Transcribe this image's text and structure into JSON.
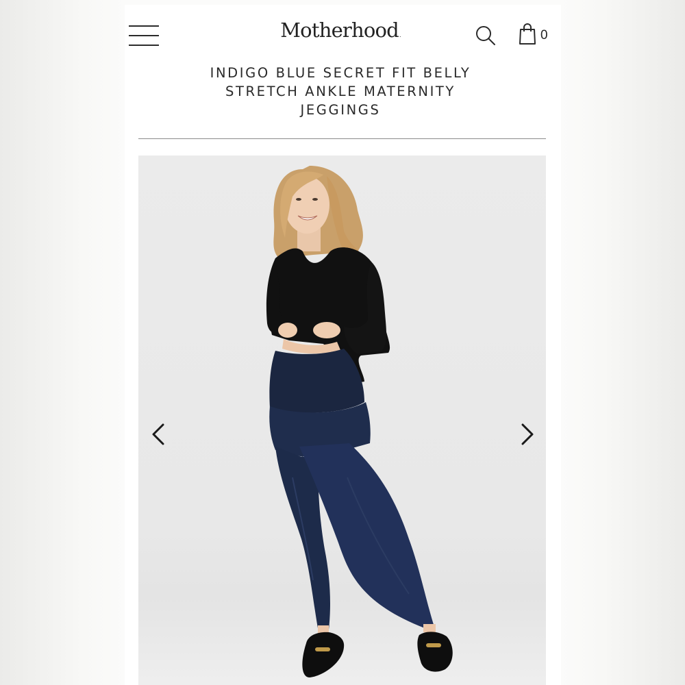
{
  "header": {
    "logo_text": "Motherhood",
    "logo_mark": ".",
    "menu_icon": "hamburger-menu-icon",
    "search_icon": "search-icon",
    "bag_icon": "shopping-bag-icon",
    "bag_count": "0"
  },
  "product": {
    "title_lines": [
      "INDIGO BLUE SECRET FIT BELLY",
      "STRETCH ANKLE MATERNITY",
      "JEGGINGS"
    ]
  },
  "carousel": {
    "prev_icon": "chevron-left-icon",
    "next_icon": "chevron-right-icon"
  },
  "colors": {
    "text": "#222222",
    "background": "#ffffff",
    "photo_background": "#e9e9e9",
    "denim": "#1f2d4d"
  }
}
